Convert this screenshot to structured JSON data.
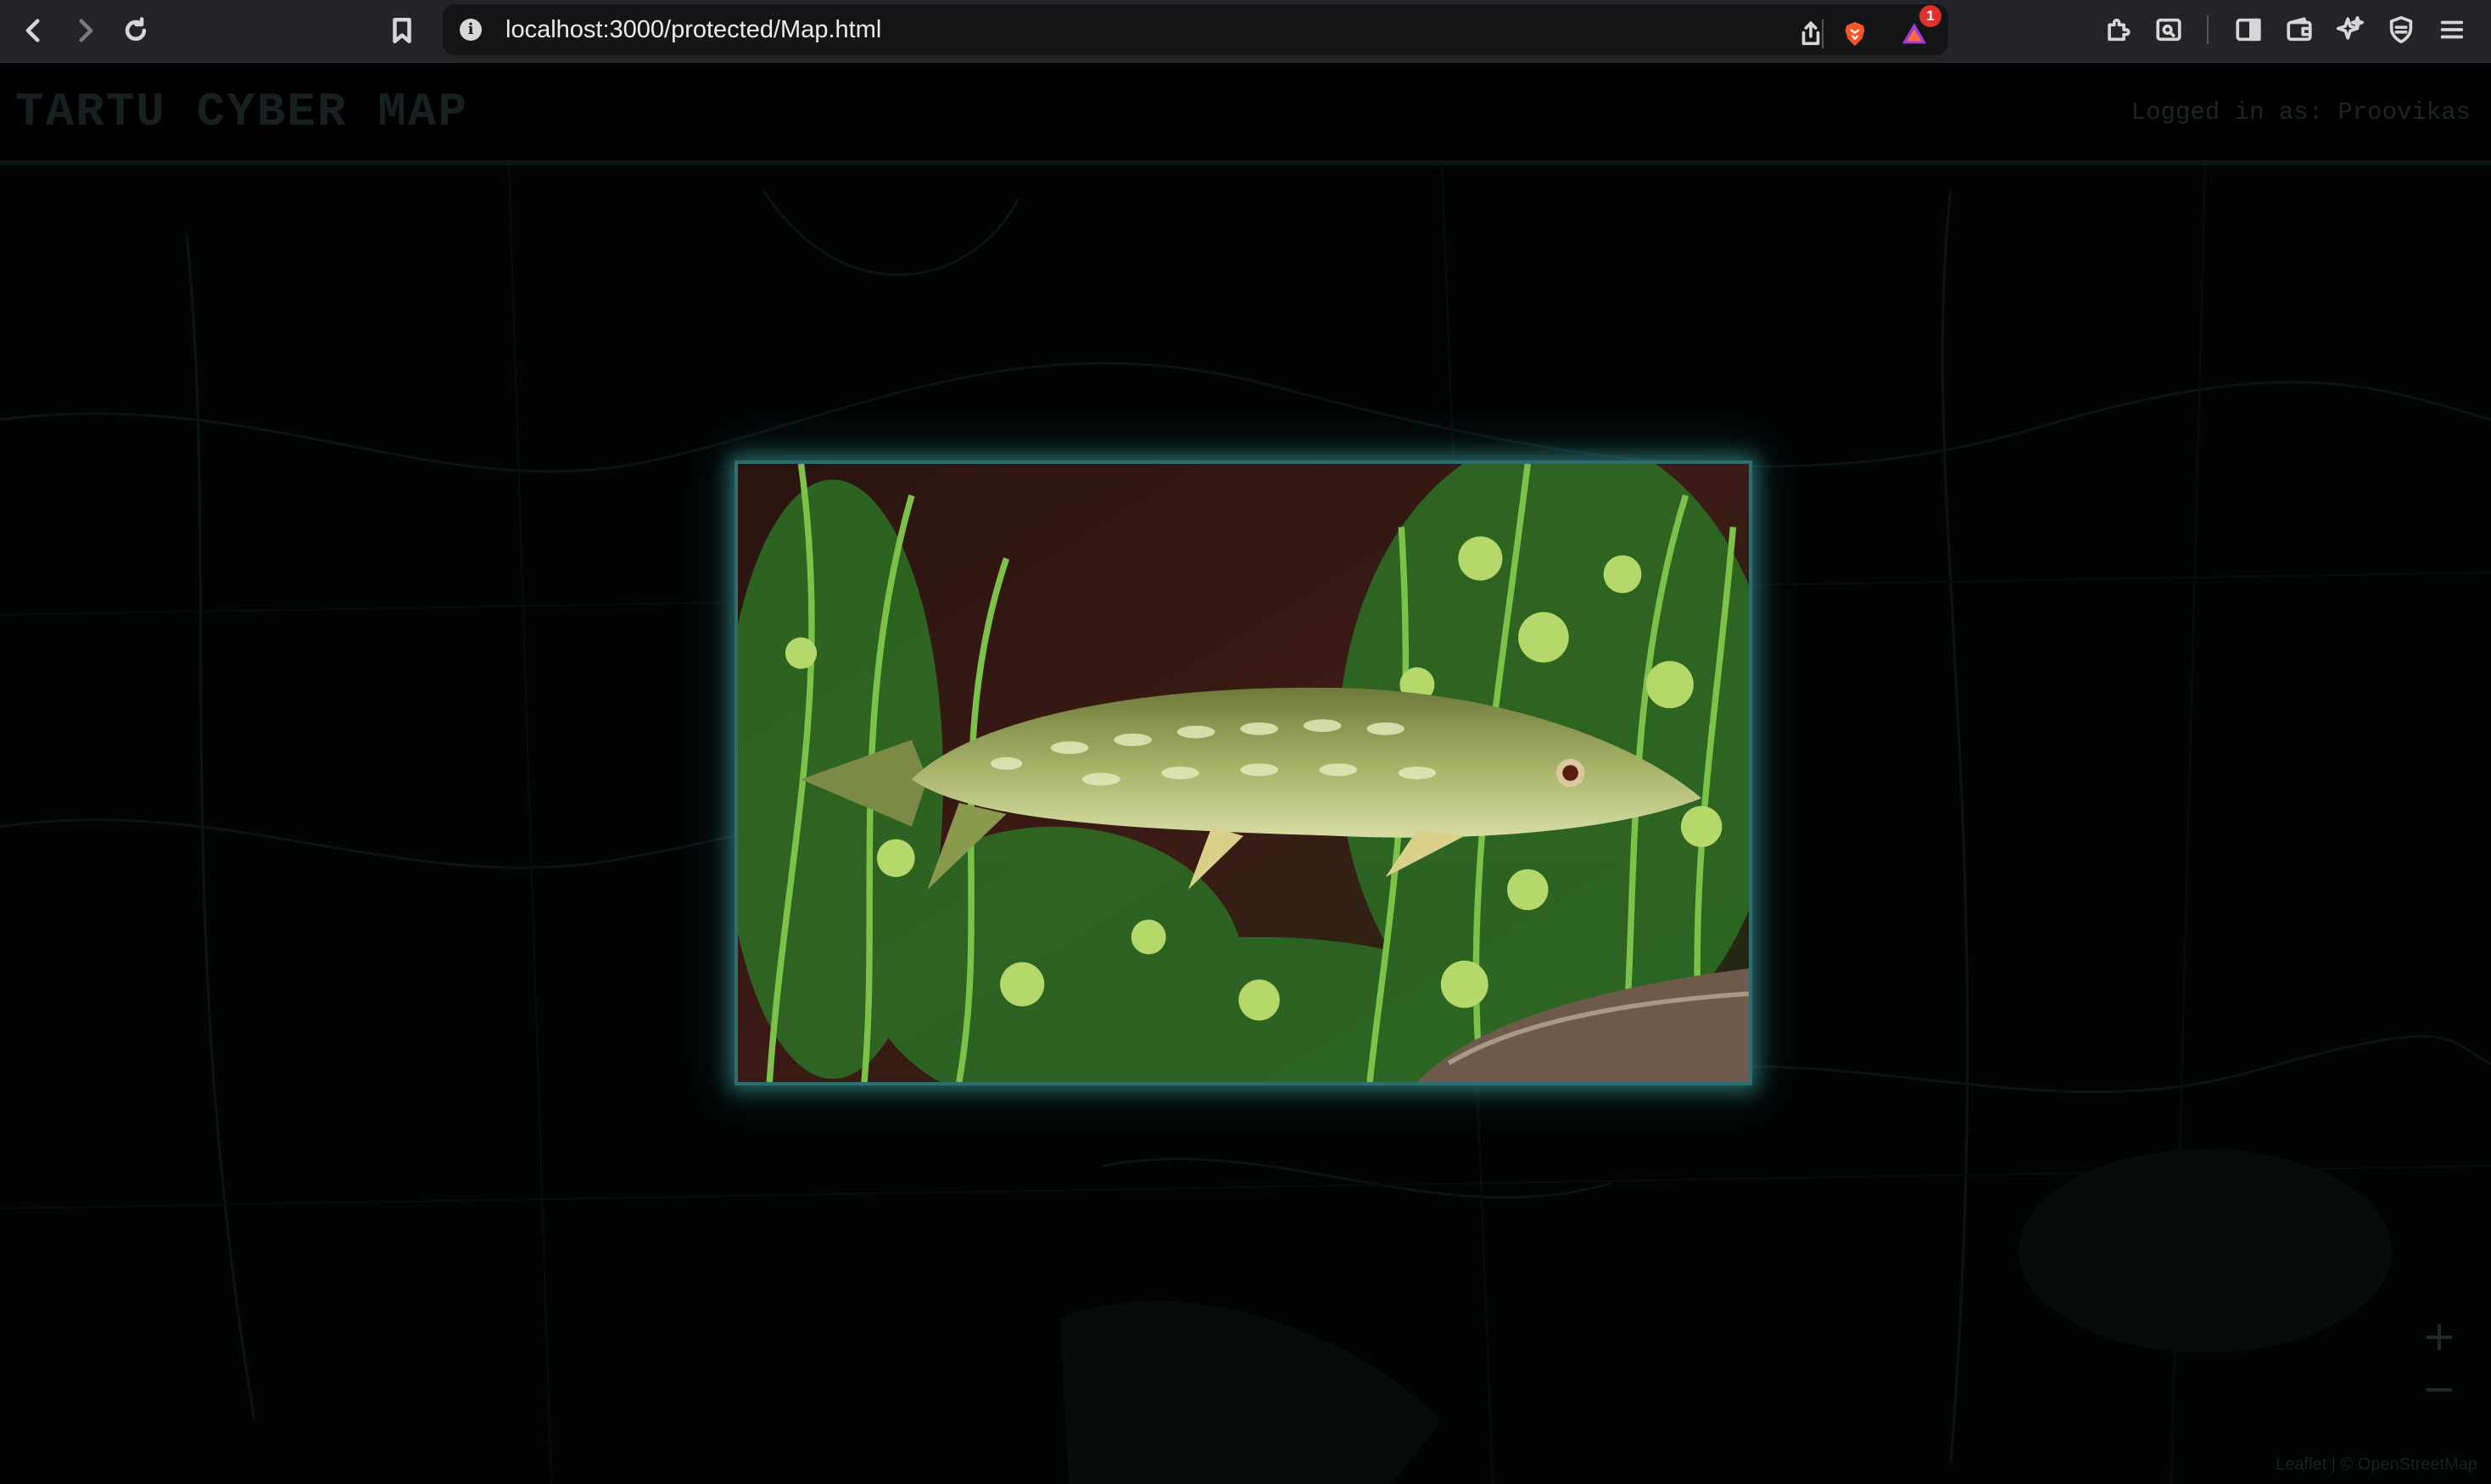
{
  "browser": {
    "url": "localhost:3000/protected/Map.html",
    "notification_count": "1"
  },
  "header": {
    "title": "TARTU CYBER MAP",
    "login_text": "Logged in as: Proovikas"
  },
  "popup": {
    "image_subject": "pike fish among aquatic plants"
  },
  "map_controls": {
    "zoom_in": "+",
    "zoom_out": "−",
    "attribution": "Leaflet | © OpenStreetMap"
  },
  "colors": {
    "chrome_bg": "#232427",
    "page_bg": "#020303",
    "glow_accent": "#46aaaa"
  }
}
